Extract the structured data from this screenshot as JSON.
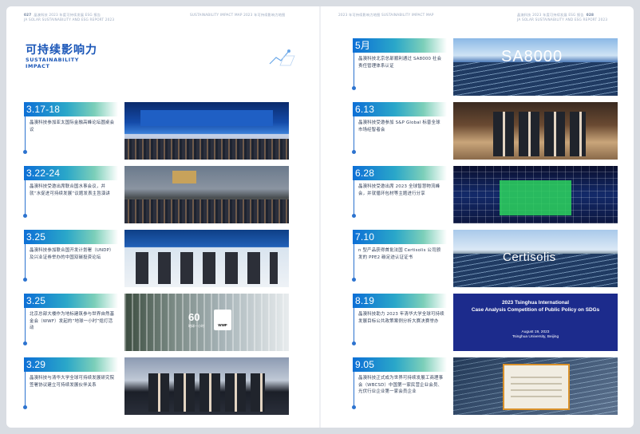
{
  "header": {
    "left_page_num": "027",
    "left_line1": "晶澳科技 2023 年度可持续发展 ESG 报告",
    "left_line2": "JA SOLAR SUSTAINABILITY AND ESG REPORT 2023",
    "left_right_text": "SUSTAINABILITY IMPACT MAP 2023 年可持续影响力地图",
    "right_left_text": "2023 年可持续影响力地图 SUSTAINABILITY IMPACT MAP",
    "right_page_num": "028",
    "right_line1": "晶澳科技 2023 年度可持续发展 ESG 报告",
    "right_line2": "JA SOLAR SUSTAINABILITY AND ESG REPORT 2023"
  },
  "title": {
    "cn": "可持续影响力",
    "en_line1": "SUSTAINABILITY",
    "en_line2": "IMPACT"
  },
  "left_entries": [
    {
      "date": "3.17-18",
      "text": "晶澳科技参加亚太国际金融高峰论坛圆桌会议"
    },
    {
      "date": "3.22-24",
      "text": "晶澳科技受邀出席联合国水事会议，并就“水促进可持续发展”议题发表主旨演讲"
    },
    {
      "date": "3.25",
      "text": "晶澳科技参加联合国开发计划署（UNDP）及兴业证券举办的中国双碳投资论坛"
    },
    {
      "date": "3.25",
      "text": "北京总部大楼作为地标建筑参与世界自然基金会（WWF）发起的“地球一小时”熄灯活动"
    },
    {
      "date": "3.29",
      "text": "晶澳科技与清华大学全球可持续发展研究院签署协议建立可持续发展伙伴关系"
    }
  ],
  "right_entries": [
    {
      "date": "5月",
      "text": "晶澳科技北京总部顺利通过 SA8000 社会责任管理体系认证"
    },
    {
      "date": "6.13",
      "text": "晶澳科技受邀参加 S&P Global 标普全球市场经智者会"
    },
    {
      "date": "6.28",
      "text": "晶澳科技受邀出席 2023 全球智慧物流峰会，并就循环包材等主题进行分享"
    },
    {
      "date": "7.10",
      "text": "n 型产品获得首批法国 Certisolis 公司颁发的 PPE2 碳足迹认证证书"
    },
    {
      "date": "8.19",
      "text": "晶澳科技助力 2023 年清华大学全球可持续发展目标公共政策案例分析大赛决赛举办"
    },
    {
      "date": "9.05",
      "text": "晶澳科技正式成为世界可持续发展工商理事会（WBCSD）中国第一家民营企业会员、光伏行业企业第一家会员企业"
    }
  ],
  "photo_text": {
    "sa8000": "SA8000",
    "certisolis": "Certisolis",
    "tsinghua_title_l1": "2023 Tsinghua International",
    "tsinghua_title_l2": "Case Analysis Competition of Public Policy on SDGs",
    "tsinghua_date": "August 19, 2023",
    "tsinghua_place": "Tsinghua University, Beijing",
    "earth_hour_num": "60",
    "earth_hour_sub": "地球一小时",
    "wwf": "WWF"
  }
}
